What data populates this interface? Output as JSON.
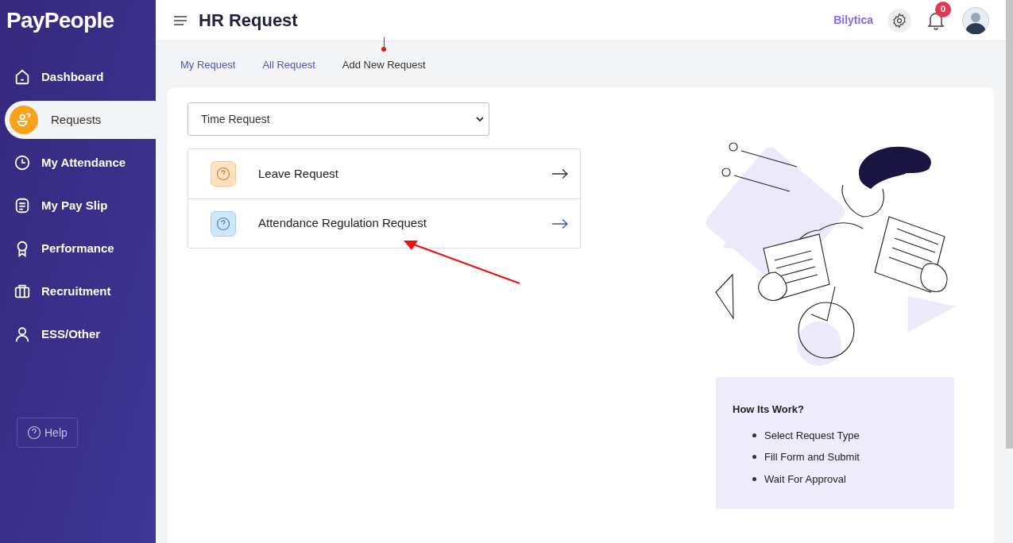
{
  "sidebar": {
    "logo": "PayPeople",
    "items": [
      {
        "label": "Dashboard",
        "kind": "home",
        "selected": false
      },
      {
        "label": "Requests",
        "kind": "request",
        "selected": true
      },
      {
        "label": "My Attendance",
        "kind": "clock",
        "selected": false
      },
      {
        "label": "My Pay Slip",
        "kind": "document",
        "selected": false
      },
      {
        "label": "Performance",
        "kind": "award",
        "selected": false
      },
      {
        "label": "Recruitment",
        "kind": "briefcase",
        "selected": false
      },
      {
        "label": "ESS/Other",
        "kind": "user",
        "selected": false
      }
    ],
    "help": "Help"
  },
  "header": {
    "title": "HR Request",
    "company": "Bilytica",
    "notifications": "0"
  },
  "tabs": [
    {
      "label": "My Request",
      "selected": false
    },
    {
      "label": "All Request",
      "selected": false
    },
    {
      "label": "Add New Request",
      "selected": true
    }
  ],
  "request_type": {
    "value": "Time Request"
  },
  "requests": [
    {
      "label": "Leave Request",
      "kind": "leave"
    },
    {
      "label": "Attendance Regulation Request",
      "kind": "attendance"
    }
  ],
  "info": {
    "title": "How Its Work?",
    "steps": [
      "Select Request Type",
      "Fill Form and Submit",
      "Wait For Approval"
    ]
  }
}
